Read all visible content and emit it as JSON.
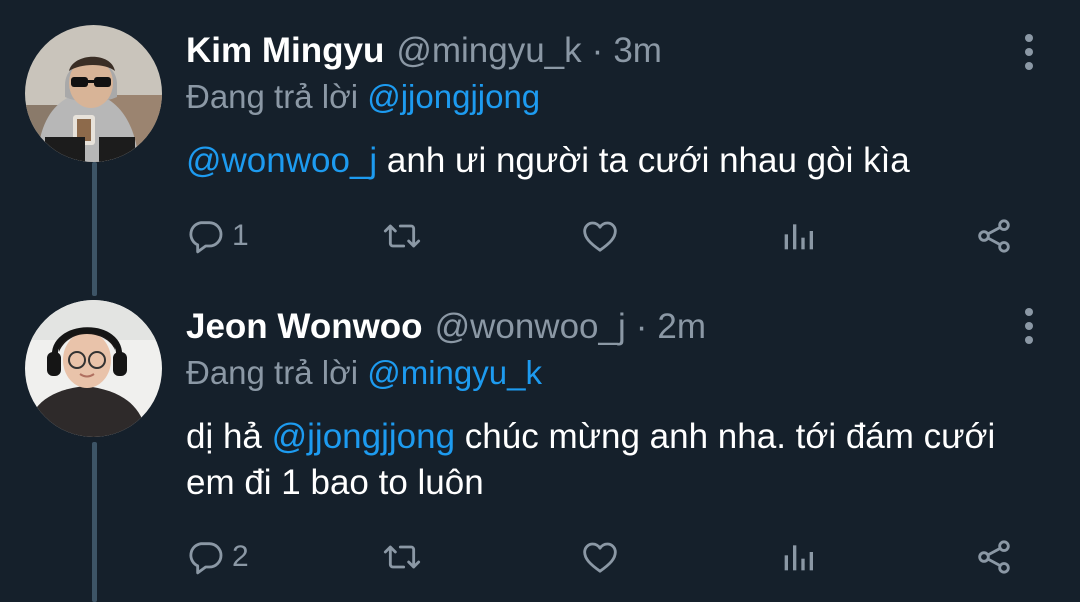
{
  "tweets": [
    {
      "author_name": "Kim Mingyu",
      "author_handle": "@mingyu_k",
      "separator": "·",
      "time": "3m",
      "replying_prefix": "Đang trả lời",
      "replying_to": "@jjongjjong",
      "body_mention": "@wonwoo_j",
      "body_text": " anh ưi người ta cưới nhau gòi kìa",
      "reply_count": "1",
      "avatar_icon": "avatar-photo-man-sunglasses-grey-hoodie"
    },
    {
      "author_name": "Jeon Wonwoo",
      "author_handle": "@wonwoo_j",
      "separator": "·",
      "time": "2m",
      "replying_prefix": "Đang trả lời",
      "replying_to": "@mingyu_k",
      "body_prefix": "dị hả ",
      "body_mention": "@jjongjjong",
      "body_text": " chúc mừng anh nha. tới đám cưới em đi 1 bao to luôn",
      "reply_count": "2",
      "avatar_icon": "avatar-photo-man-glasses-headset"
    }
  ],
  "icons": {
    "reply": "reply-bubble-icon",
    "retweet": "retweet-icon",
    "like": "heart-icon",
    "views": "analytics-bars-icon",
    "share": "share-icon",
    "more": "more-vertical-icon"
  },
  "colors": {
    "background": "#15202b",
    "text_primary": "#ffffff",
    "text_secondary": "#8b98a5",
    "accent": "#1d9bf0",
    "thread_line": "#3d5466"
  }
}
